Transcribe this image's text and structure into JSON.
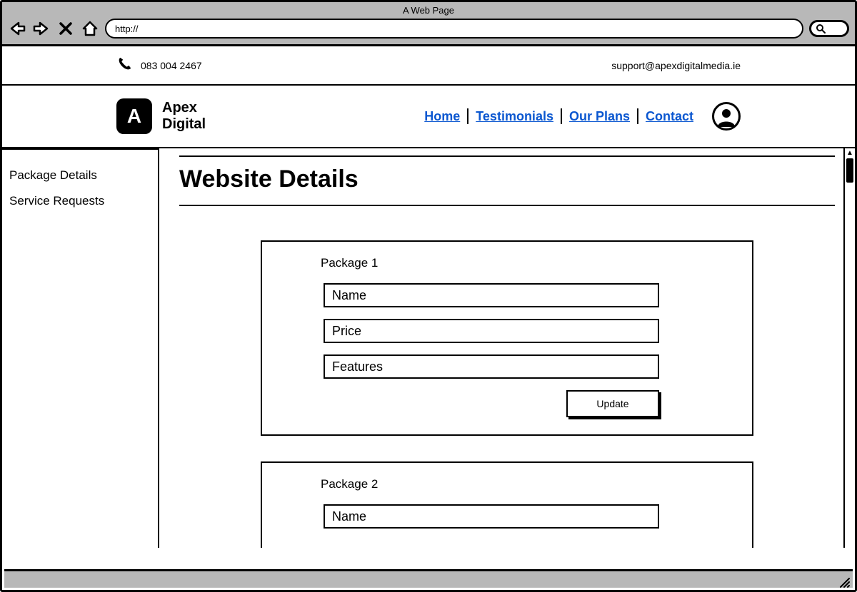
{
  "browser": {
    "title": "A Web Page",
    "url_value": "http://"
  },
  "contact": {
    "phone": "083 004 2467",
    "email": "support@apexdigitalmedia.ie"
  },
  "brand": {
    "logo_letter": "A",
    "line1": "Apex",
    "line2": "Digital"
  },
  "nav": {
    "items": [
      {
        "label": "Home"
      },
      {
        "label": "Testimonials"
      },
      {
        "label": "Our Plans"
      },
      {
        "label": "Contact"
      }
    ]
  },
  "sidebar": {
    "items": [
      {
        "label": "Package Details"
      },
      {
        "label": "Service Requests"
      }
    ]
  },
  "main": {
    "heading": "Website Details",
    "packages": [
      {
        "title": "Package 1",
        "fields": {
          "name": "Name",
          "price": "Price",
          "features": "Features"
        },
        "update_label": "Update"
      },
      {
        "title": "Package 2",
        "fields": {
          "name": "Name"
        }
      }
    ]
  }
}
